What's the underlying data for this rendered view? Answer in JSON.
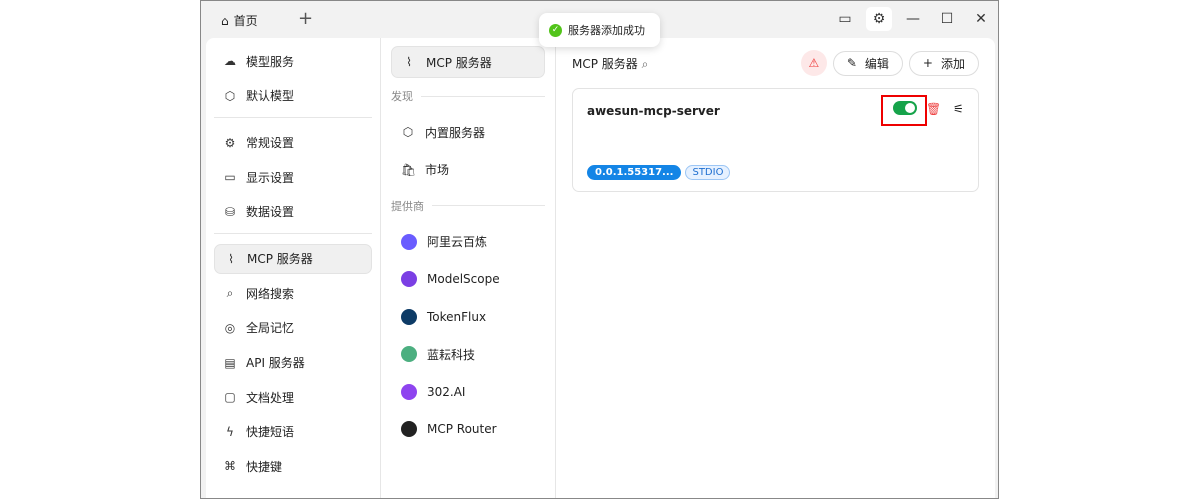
{
  "titlebar": {
    "tab_label": "首页",
    "window_controls": [
      "monitor-icon",
      "gear-icon",
      "minimize-icon",
      "maximize-icon",
      "close-icon"
    ]
  },
  "toast": {
    "message": "服务器添加成功"
  },
  "sidebar": {
    "items": [
      {
        "label": "模型服务",
        "icon": "☁"
      },
      {
        "label": "默认模型",
        "icon": "⬡"
      },
      {
        "label": "常规设置",
        "icon": "⚙"
      },
      {
        "label": "显示设置",
        "icon": "▭"
      },
      {
        "label": "数据设置",
        "icon": "⛁"
      },
      {
        "label": "MCP 服务器",
        "icon": "⌇"
      },
      {
        "label": "网络搜索",
        "icon": "⌕"
      },
      {
        "label": "全局记忆",
        "icon": "◎"
      },
      {
        "label": "API 服务器",
        "icon": "▤"
      },
      {
        "label": "文档处理",
        "icon": "▢"
      },
      {
        "label": "快捷短语",
        "icon": "ϟ"
      },
      {
        "label": "快捷键",
        "icon": "⌘"
      }
    ]
  },
  "col2": {
    "active": "MCP 服务器",
    "discover_label": "发现",
    "discover": [
      {
        "label": "内置服务器",
        "icon": "⬡"
      },
      {
        "label": "市场",
        "icon": "🛍"
      }
    ],
    "providers_label": "提供商",
    "providers": [
      {
        "label": "阿里云百炼",
        "color": "#6a5cff"
      },
      {
        "label": "ModelScope",
        "color": "#7b3fe4"
      },
      {
        "label": "TokenFlux",
        "color": "#0d3b66"
      },
      {
        "label": "蓝耘科技",
        "color": "#4caf80"
      },
      {
        "label": "302.AI",
        "color": "#8e44ef"
      },
      {
        "label": "MCP Router",
        "color": "#222222"
      }
    ]
  },
  "main": {
    "title": "MCP 服务器",
    "edit_label": "编辑",
    "add_label": "添加",
    "server": {
      "name": "awesun-mcp-server",
      "enabled": true,
      "version_tag": "0.0.1.55317...",
      "type_tag": "STDIO"
    }
  }
}
